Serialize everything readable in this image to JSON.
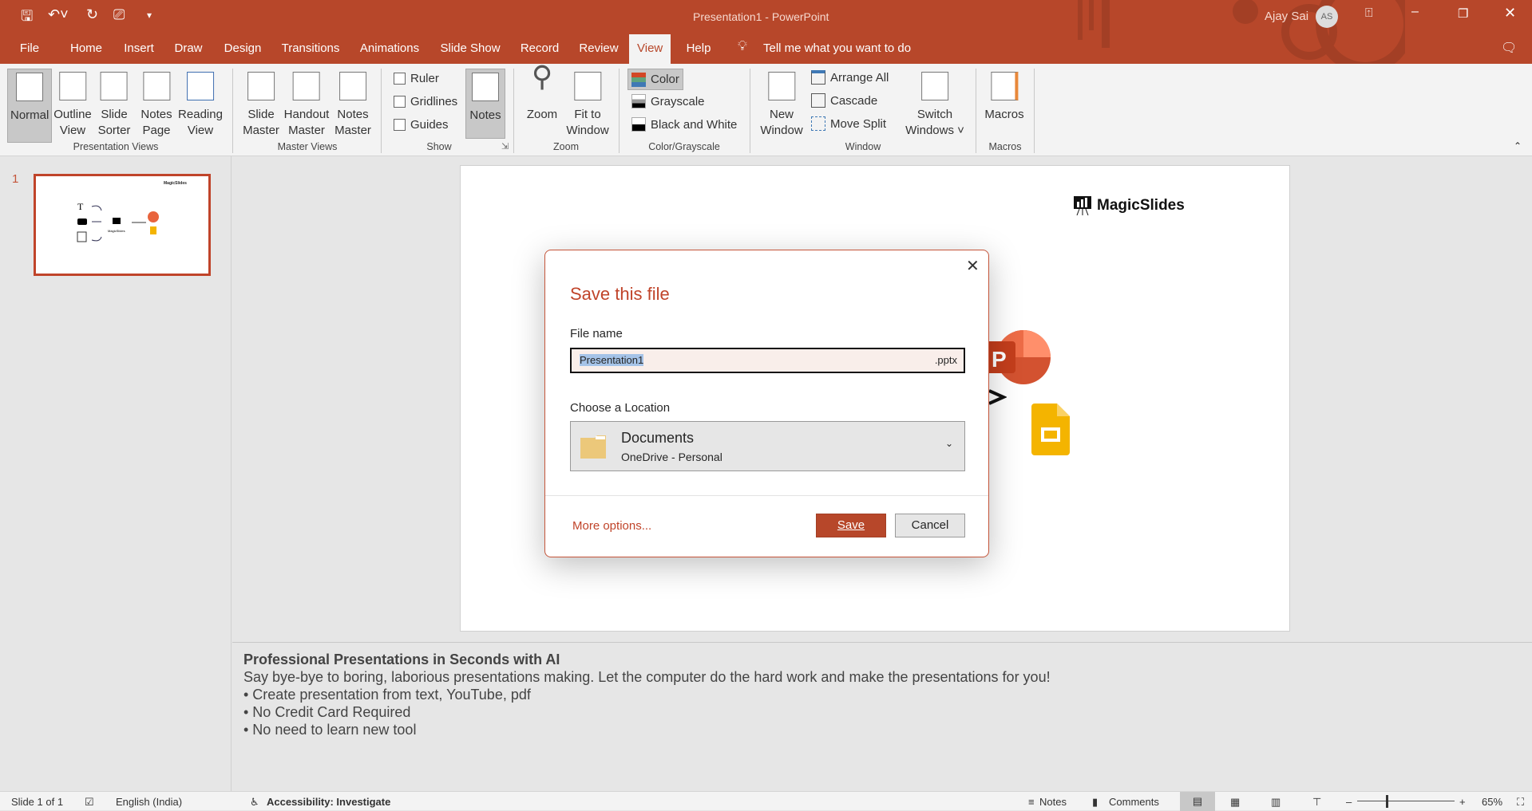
{
  "window": {
    "title": "Presentation1  -  PowerPoint",
    "user": "Ajay Sai",
    "initials": "AS"
  },
  "tabs": [
    "File",
    "Home",
    "Insert",
    "Draw",
    "Design",
    "Transitions",
    "Animations",
    "Slide Show",
    "Record",
    "Review",
    "View",
    "Help"
  ],
  "tell_me": "Tell me what you want to do",
  "ribbon": {
    "presentation_views": {
      "label": "Presentation Views",
      "buttons": [
        [
          "Normal",
          ""
        ],
        [
          "Outline",
          "View"
        ],
        [
          "Slide",
          "Sorter"
        ],
        [
          "Notes",
          "Page"
        ],
        [
          "Reading",
          "View"
        ]
      ]
    },
    "master_views": {
      "label": "Master Views",
      "buttons": [
        [
          "Slide",
          "Master"
        ],
        [
          "Handout",
          "Master"
        ],
        [
          "Notes",
          "Master"
        ]
      ]
    },
    "show": {
      "label": "Show",
      "checks": [
        "Ruler",
        "Gridlines",
        "Guides"
      ],
      "notes": "Notes"
    },
    "zoom": {
      "label": "Zoom",
      "zoom": "Zoom",
      "fit": [
        "Fit to",
        "Window"
      ]
    },
    "color": {
      "label": "Color/Grayscale",
      "items": [
        "Color",
        "Grayscale",
        "Black and White"
      ]
    },
    "window": {
      "label": "Window",
      "new": [
        "New",
        "Window"
      ],
      "items": [
        "Arrange All",
        "Cascade",
        "Move Split"
      ],
      "switch": [
        "Switch",
        "Windows ˅"
      ]
    },
    "macros": {
      "label": "Macros",
      "button": "Macros"
    }
  },
  "thumbnail": {
    "number": "1",
    "logo": "MagicSlides"
  },
  "slide": {
    "logo": "MagicSlides",
    "ppt_letter": "P"
  },
  "notes": {
    "title": "Professional Presentations in Seconds with AI",
    "body": "Say bye-bye to boring, laborious presentations making. Let the computer do the hard work and make the presentations for you!",
    "bullets": [
      "• Create presentation from text, YouTube, pdf",
      "• No Credit Card Required",
      "• No need to learn new tool"
    ]
  },
  "status": {
    "slide": "Slide 1 of 1",
    "language": "English (India)",
    "accessibility": "Accessibility: Investigate",
    "notes": "Notes",
    "comments": "Comments",
    "zoom": "65%"
  },
  "dialog": {
    "title": "Save this file",
    "file_label": "File name",
    "file_value": "Presentation1",
    "ext": ".pptx",
    "location_label": "Choose a Location",
    "location_name": "Documents",
    "location_sub": "OneDrive - Personal",
    "more": "More options...",
    "save": "Save",
    "cancel": "Cancel"
  }
}
